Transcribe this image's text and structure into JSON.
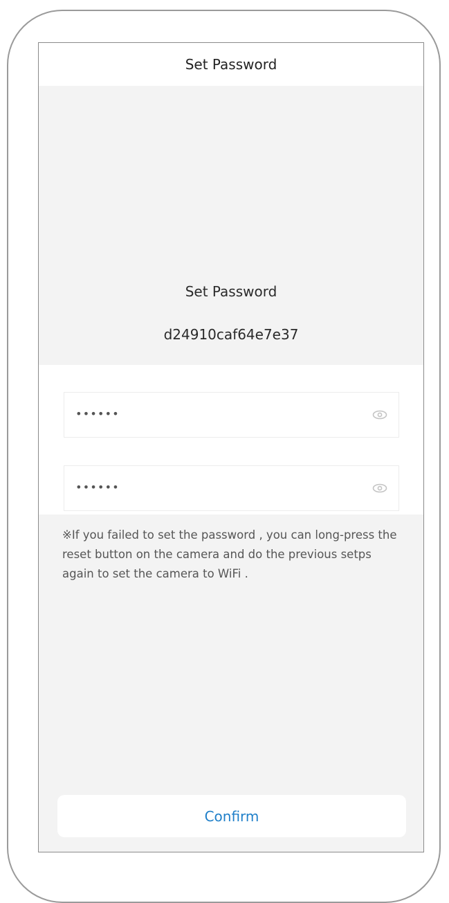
{
  "nav": {
    "title": "Set Password"
  },
  "header": {
    "title": "Set Password",
    "device_id": "d24910caf64e7e37"
  },
  "form": {
    "password": {
      "value": "••••••",
      "icon": "eye-icon"
    },
    "confirm_password": {
      "value": "••••••",
      "icon": "eye-icon"
    }
  },
  "hint": {
    "text": "※If you failed to set the password , you can long-press the reset button on the camera and do the previous setps again to set the camera to WiFi ."
  },
  "actions": {
    "confirm_label": "Confirm"
  },
  "colors": {
    "accent": "#1f7fc9",
    "background": "#f3f3f3"
  }
}
